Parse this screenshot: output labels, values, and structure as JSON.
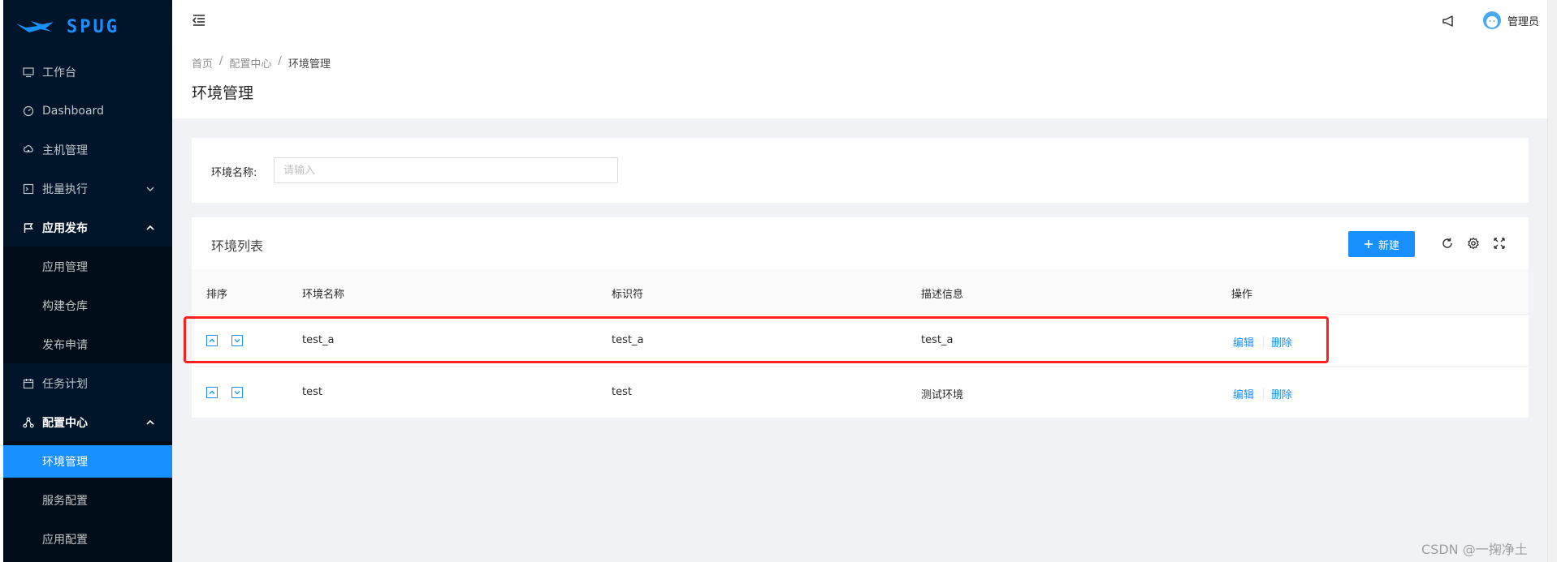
{
  "app": {
    "logo_text": "SPUG"
  },
  "colors": {
    "sidebar_bg": "#001529",
    "accent": "#1890ff",
    "highlight": "#ff1f1f"
  },
  "sidebar": {
    "items": [
      {
        "label": "工作台",
        "icon": "desktop-icon"
      },
      {
        "label": "Dashboard",
        "icon": "dashboard-icon"
      },
      {
        "label": "主机管理",
        "icon": "cloud-server-icon"
      },
      {
        "label": "批量执行",
        "icon": "code-icon",
        "expanded": false
      },
      {
        "label": "应用发布",
        "icon": "flag-icon",
        "expanded": true,
        "children": [
          {
            "label": "应用管理"
          },
          {
            "label": "构建仓库"
          },
          {
            "label": "发布申请"
          }
        ]
      },
      {
        "label": "任务计划",
        "icon": "schedule-icon"
      },
      {
        "label": "配置中心",
        "icon": "cluster-icon",
        "expanded": true,
        "children": [
          {
            "label": "环境管理",
            "active": true
          },
          {
            "label": "服务配置"
          },
          {
            "label": "应用配置"
          }
        ]
      }
    ]
  },
  "header": {
    "user_name": "管理员"
  },
  "breadcrumb": [
    "首页",
    "配置中心",
    "环境管理"
  ],
  "breadcrumb_separator": "/",
  "page_title": "环境管理",
  "search": {
    "label": "环境名称:",
    "placeholder": "请输入",
    "value": ""
  },
  "table": {
    "title": "环境列表",
    "new_button_label": "新建",
    "columns": [
      "排序",
      "环境名称",
      "标识符",
      "描述信息",
      "操作"
    ],
    "rows": [
      {
        "name": "test_a",
        "key": "test_a",
        "desc": "test_a",
        "highlighted": true
      },
      {
        "name": "test",
        "key": "test",
        "desc": "测试环境",
        "highlighted": false
      }
    ],
    "actions": {
      "edit": "编辑",
      "delete": "删除"
    }
  },
  "watermark": "CSDN @一掬净土"
}
